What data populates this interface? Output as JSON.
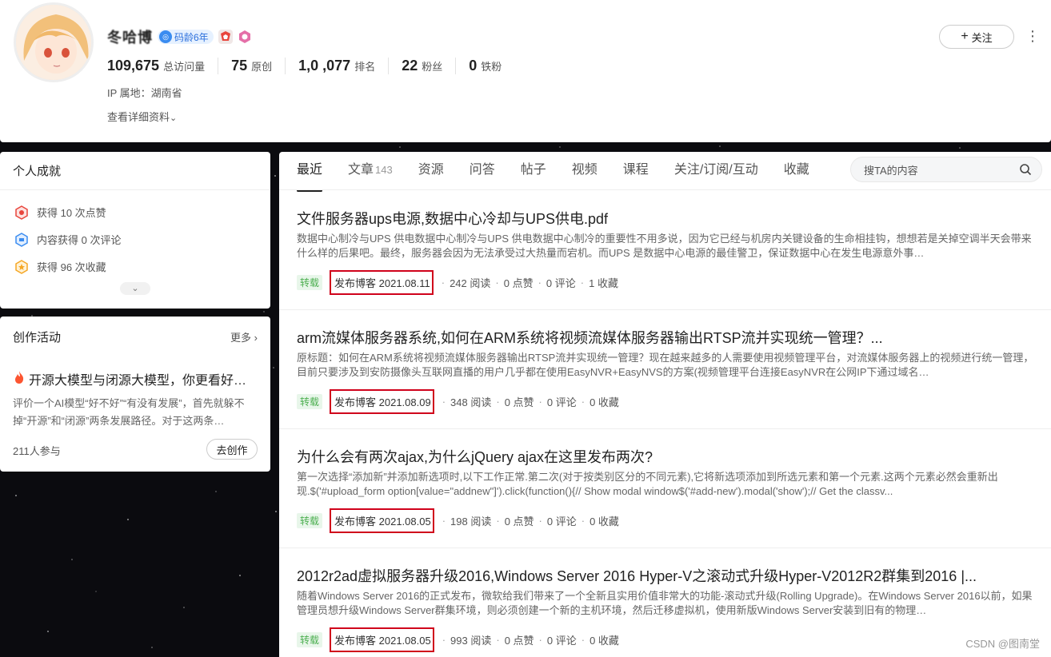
{
  "profile": {
    "username": "冬哈博",
    "code_age_badge": "码龄6年",
    "stats": [
      {
        "value": "109,675",
        "label": "总访问量"
      },
      {
        "value": "75",
        "label": "原创"
      },
      {
        "value": "1,0 ,077",
        "label": "排名"
      },
      {
        "value": "22",
        "label": "粉丝"
      },
      {
        "value": "0",
        "label": "铁粉"
      }
    ],
    "ip_location": "IP 属地：湖南省",
    "more_info": "查看详细资料",
    "follow_button": "关注"
  },
  "achievements": {
    "title": "个人成就",
    "items": [
      {
        "text": "获得 10 次点赞",
        "icon": "like-badge-icon",
        "color": "#e8453c"
      },
      {
        "text": "内容获得 0 次评论",
        "icon": "comment-badge-icon",
        "color": "#3a8cf0"
      },
      {
        "text": "获得 96 次收藏",
        "icon": "star-badge-icon",
        "color": "#f5a623"
      }
    ]
  },
  "activity": {
    "title": "创作活动",
    "more": "更多",
    "headline": "开源大模型与闭源大模型，你更看好…",
    "description": "评价一个AI模型“好不好”“有没有发展”，首先就躲不掉“开源”和“闭源”两条发展路径。对于这两条…",
    "participants": "211人参与",
    "button": "去创作"
  },
  "tabs": [
    {
      "label": "最近",
      "count": ""
    },
    {
      "label": "文章",
      "count": "143"
    },
    {
      "label": "资源",
      "count": ""
    },
    {
      "label": "问答",
      "count": ""
    },
    {
      "label": "帖子",
      "count": ""
    },
    {
      "label": "视频",
      "count": ""
    },
    {
      "label": "课程",
      "count": ""
    },
    {
      "label": "关注/订阅/互动",
      "count": ""
    },
    {
      "label": "收藏",
      "count": ""
    }
  ],
  "search": {
    "placeholder": "搜TA的内容"
  },
  "articles": [
    {
      "title": "文件服务器ups电源,数据中心冷却与UPS供电.pdf",
      "desc": "数据中心制冷与UPS 供电数据中心制冷与UPS 供电数据中心制冷的重要性不用多说，因为它已经与机房内关键设备的生命相挂钩，想想若是关掉空调半天会带来什么样的后果吧。最终，服务器会因为无法承受过大热量而宕机。而UPS 是数据中心电源的最佳警卫，保证数据中心在发生电源意外事…",
      "tag": "转载",
      "published": "发布博客 2021.08.11",
      "reads": "242 阅读",
      "likes": "0 点赞",
      "comments": "0 评论",
      "favorites": "1 收藏"
    },
    {
      "title": "arm流媒体服务器系统,如何在ARM系统将视频流媒体服务器输出RTSP流并实现统一管理？...",
      "desc": "原标题：如何在ARM系统将视频流媒体服务器输出RTSP流并实现统一管理？现在越来越多的人需要使用视频管理平台，对流媒体服务器上的视频进行统一管理，目前只要涉及到安防摄像头互联网直播的用户几乎都在使用EasyNVR+EasyNVS的方案(视频管理平台连接EasyNVR在公网IP下通过域名…",
      "tag": "转载",
      "published": "发布博客 2021.08.09",
      "reads": "348 阅读",
      "likes": "0 点赞",
      "comments": "0 评论",
      "favorites": "0 收藏"
    },
    {
      "title": "为什么会有两次ajax,为什么jQuery ajax在这里发布两次?",
      "desc": "第一次选择“添加新”并添加新选项时,以下工作正常.第二次(对于按类别区分的不同元素),它将新选项添加到所选元素和第一个元素.这两个元素必然会重新出现.$('#upload_form option[value=\"addnew\"]').click(function(){// Show modal window$('#add-new').modal('show');// Get the classv...",
      "tag": "转载",
      "published": "发布博客 2021.08.05",
      "reads": "198 阅读",
      "likes": "0 点赞",
      "comments": "0 评论",
      "favorites": "0 收藏"
    },
    {
      "title": "2012r2ad虚拟服务器升级2016,Windows Server 2016 Hyper-V之滚动式升级Hyper-V2012R2群集到2016 |...",
      "desc": "随着Windows Server 2016的正式发布，微软给我们带来了一个全新且实用价值非常大的功能-滚动式升级(Rolling Upgrade)。在Windows Server 2016以前，如果管理员想升级Windows Server群集环境，则必须创建一个新的主机环境，然后迁移虚拟机，使用新版Windows Server安装到旧有的物理…",
      "tag": "转载",
      "published": "发布博客 2021.08.05",
      "reads": "993 阅读",
      "likes": "0 点赞",
      "comments": "0 评论",
      "favorites": "0 收藏"
    }
  ],
  "watermark": "CSDN @图南堂"
}
